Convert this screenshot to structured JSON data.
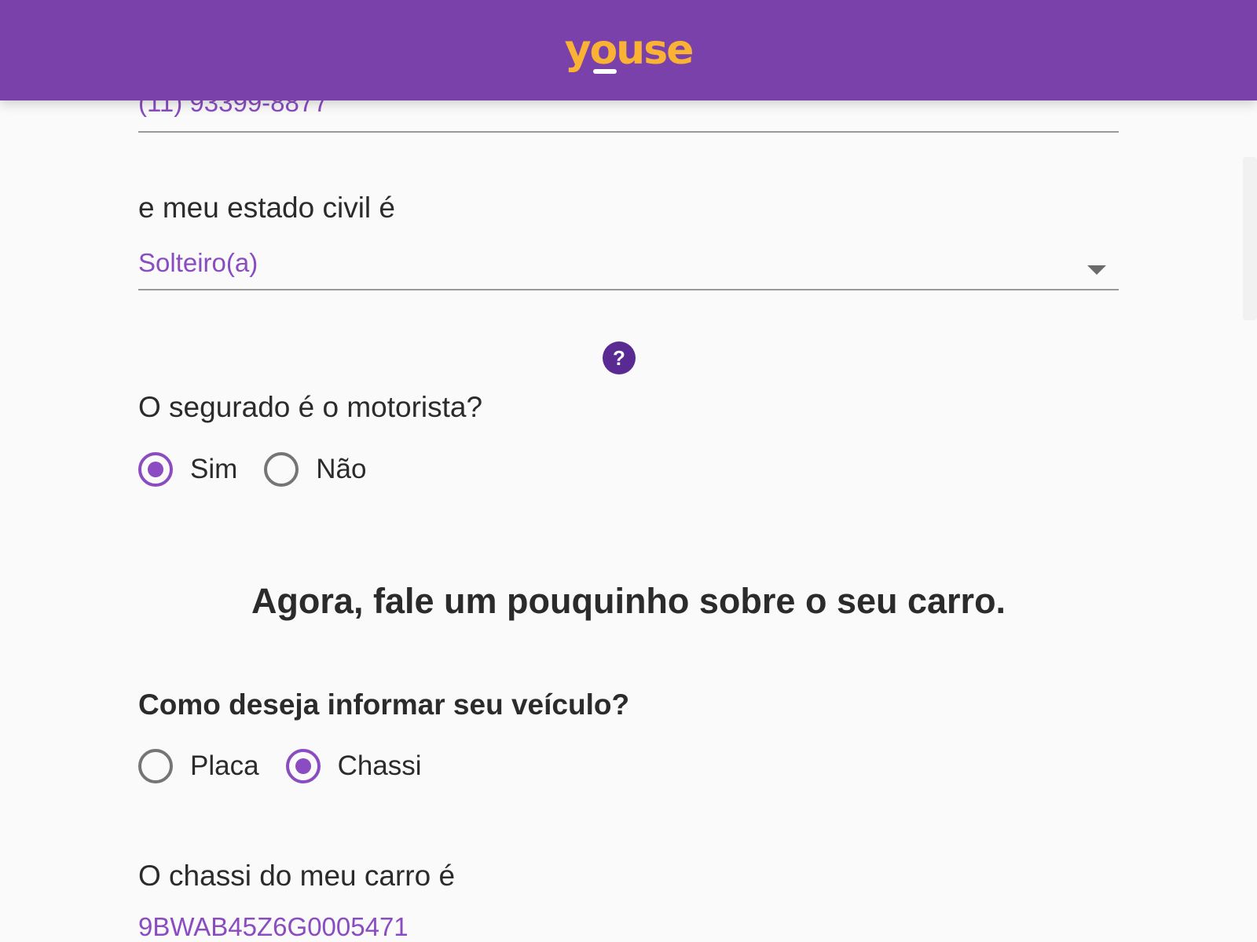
{
  "header": {
    "logo_text": "youse",
    "colors": {
      "background": "#7b41ab",
      "logo": "#f9b233"
    }
  },
  "form": {
    "phone": {
      "value": "(11) 93399-8877"
    },
    "marital_status": {
      "label": "e meu estado civil é",
      "selected": "Solteiro(a)"
    },
    "help_icon": {
      "glyph": "?",
      "icon": "help-icon"
    },
    "insured_is_driver": {
      "question": "O segurado é o motorista?",
      "options": [
        {
          "label": "Sim",
          "checked": true
        },
        {
          "label": "Não",
          "checked": false
        }
      ]
    },
    "section_title": "Agora, fale um pouquinho sobre o seu carro.",
    "vehicle_input_method": {
      "question": "Como deseja informar seu veículo?",
      "options": [
        {
          "label": "Placa",
          "checked": false
        },
        {
          "label": "Chassi",
          "checked": true
        }
      ]
    },
    "chassis": {
      "label": "O chassi do meu carro é",
      "value": "9BWAB45Z6G0005471"
    }
  },
  "colors": {
    "accent": "#8a4cc0",
    "text": "#2b2b2b",
    "help_icon_bg": "#5a2a93"
  }
}
